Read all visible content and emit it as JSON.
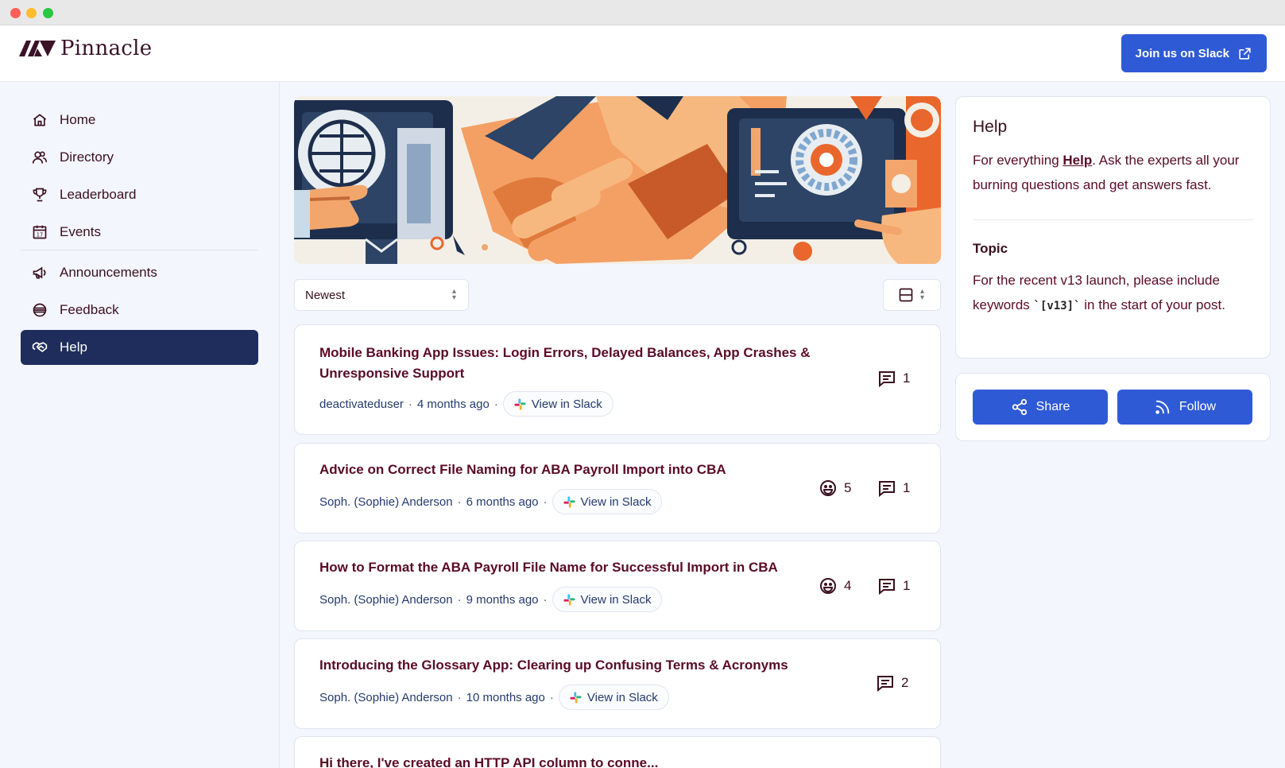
{
  "app": {
    "name": "Pinnacle"
  },
  "header": {
    "slack_button_label": "Join us on Slack"
  },
  "sidebar": {
    "items": [
      {
        "label": "Home",
        "icon": "home-icon"
      },
      {
        "label": "Directory",
        "icon": "people-icon"
      },
      {
        "label": "Leaderboard",
        "icon": "trophy-icon"
      },
      {
        "label": "Events",
        "icon": "calendar-icon"
      },
      {
        "label": "Announcements",
        "icon": "megaphone-icon"
      },
      {
        "label": "Feedback",
        "icon": "feedback-icon"
      },
      {
        "label": "Help",
        "icon": "handshake-icon",
        "active": true
      }
    ]
  },
  "controls": {
    "sort_value": "Newest"
  },
  "posts": [
    {
      "title_line1": "Mobile Banking App Issues: Login Errors, Delayed Balances, App Crashes &",
      "title_line2": "Unresponsive Support",
      "author": "deactivateduser",
      "time": "4 months ago",
      "view_label": "View in Slack",
      "comments": "1"
    },
    {
      "title_line1": "Advice on Correct File Naming for ABA Payroll Import into CBA",
      "author": "Soph. (Sophie) Anderson",
      "time": "6 months ago",
      "view_label": "View in Slack",
      "reactions": "5",
      "comments": "1"
    },
    {
      "title_line1": "How to Format the ABA Payroll File Name for Successful Import in CBA",
      "author": "Soph. (Sophie) Anderson",
      "time": "9 months ago",
      "view_label": "View in Slack",
      "reactions": "4",
      "comments": "1"
    },
    {
      "title_line1": "Introducing the Glossary App: Clearing up Confusing Terms & Acronyms",
      "author": "Soph. (Sophie) Anderson",
      "time": "10 months ago",
      "view_label": "View in Slack",
      "comments": "2"
    },
    {
      "title_line1": "Hi there, I've created an HTTP API column to conne..."
    }
  ],
  "help_card": {
    "title": "Help",
    "desc_prefix": "For everything ",
    "desc_link": "Help",
    "desc_suffix": ". Ask the experts all your burning questions and get answers fast.",
    "topic_title": "Topic",
    "topic_prefix": "For the recent v13 launch, please include keywords ",
    "topic_code": "`[v13]`",
    "topic_suffix": " in the start of your post."
  },
  "actions": {
    "share_label": "Share",
    "follow_label": "Follow"
  },
  "colors": {
    "primary": "#2f5ad6",
    "nav_active": "#1e2d5c",
    "title": "#5a0b26",
    "background": "#f3f6fd"
  }
}
